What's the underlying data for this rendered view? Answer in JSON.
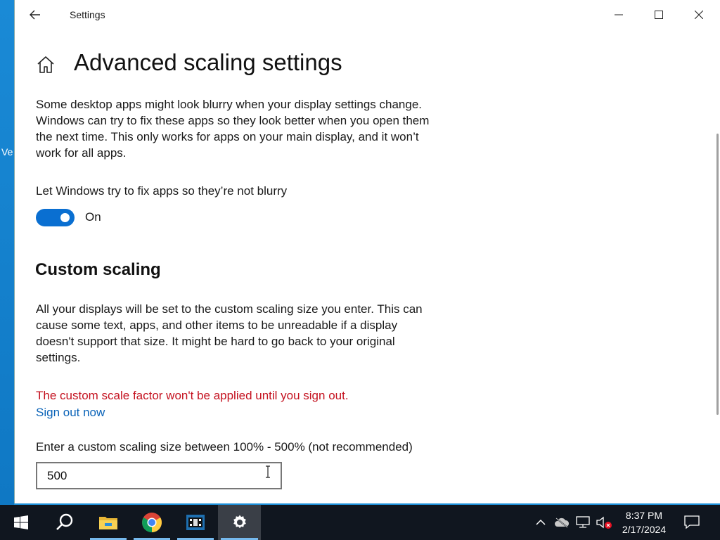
{
  "desktop": {
    "partial_icon_text": "Ve"
  },
  "window": {
    "title": "Settings",
    "controls": {
      "minimize": "minimize-icon",
      "maximize": "maximize-icon",
      "close": "close-icon"
    }
  },
  "page": {
    "title": "Advanced scaling settings",
    "intro": "Some desktop apps might look blurry when your display settings change. Windows can try to fix these apps so they look better when you open them the next time. This only works for apps on your main display, and it won’t work for all apps.",
    "fix_blurry": {
      "label": "Let Windows try to fix apps so they’re not blurry",
      "state": "On",
      "enabled": true
    },
    "custom_scaling": {
      "heading": "Custom scaling",
      "description": "All your displays will be set to the custom scaling size you enter. This can cause some text, apps, and other items to be unreadable if a display doesn't support that size. It might be hard to go back to your original settings.",
      "warning": "The custom scale factor won't be applied until you sign out.",
      "sign_out_link": "Sign out now",
      "input_label": "Enter a custom scaling size between 100% - 500% (not recommended)",
      "input_value": "500"
    }
  },
  "colors": {
    "accent": "#0a6fd1",
    "warning": "#c4111f",
    "link": "#0a63b8",
    "taskbar": "#10161f"
  },
  "taskbar": {
    "items": [
      "windows-start-icon",
      "search-icon",
      "file-explorer-icon",
      "chrome-icon",
      "media-player-icon",
      "settings-gear-icon"
    ],
    "active": "settings-gear-icon",
    "clock": {
      "time": "8:37 PM",
      "date": "2/17/2024"
    }
  }
}
